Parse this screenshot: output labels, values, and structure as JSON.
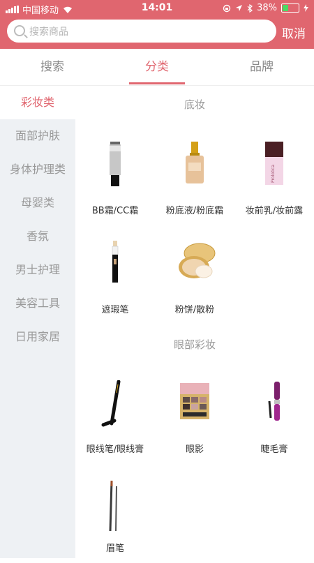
{
  "status_bar": {
    "carrier": "中国移动",
    "time": "14:01",
    "battery": "38%",
    "battery_level": 0.38
  },
  "search": {
    "placeholder": "搜索商品",
    "value": "",
    "cancel_label": "取消"
  },
  "tabs": [
    {
      "label": "搜索"
    },
    {
      "label": "分类"
    },
    {
      "label": "品牌"
    }
  ],
  "active_tab": 1,
  "sidebar": {
    "items": [
      {
        "label": "彩妆类"
      },
      {
        "label": "面部护肤"
      },
      {
        "label": "身体护理类"
      },
      {
        "label": "母婴类"
      },
      {
        "label": "香氛"
      },
      {
        "label": "男士护理"
      },
      {
        "label": "美容工具"
      },
      {
        "label": "日用家居"
      }
    ],
    "active": 0
  },
  "sections": [
    {
      "title": "底妆",
      "products": [
        {
          "label": "BB霜/CC霜",
          "icon": "bb-cream-tube-icon"
        },
        {
          "label": "粉底液/粉底霜",
          "icon": "foundation-bottle-icon"
        },
        {
          "label": "妆前乳/妆前露",
          "icon": "primer-bottle-icon"
        },
        {
          "label": "遮瑕笔",
          "icon": "concealer-pen-icon"
        },
        {
          "label": "粉饼/散粉",
          "icon": "powder-compact-icon"
        }
      ]
    },
    {
      "title": "眼部彩妆",
      "products": [
        {
          "label": "眼线笔/眼线膏",
          "icon": "eyeliner-pen-icon"
        },
        {
          "label": "眼影",
          "icon": "eyeshadow-palette-icon"
        },
        {
          "label": "睫毛膏",
          "icon": "mascara-icon"
        },
        {
          "label": "眉笔",
          "icon": "eyebrow-pencil-icon"
        }
      ]
    }
  ],
  "colors": {
    "accent": "#e0666f",
    "sidebar_bg": "#eef1f4"
  }
}
